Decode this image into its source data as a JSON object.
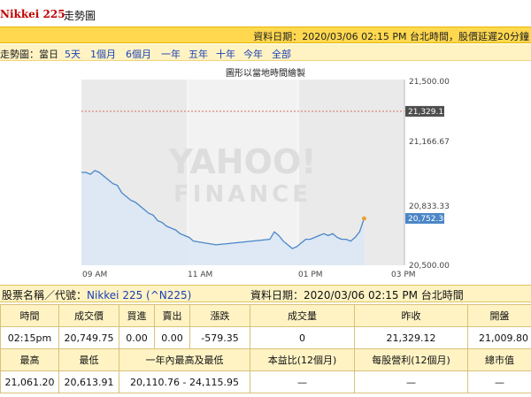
{
  "header": {
    "name": "Nikkei 225",
    "subtitle": "走勢圖"
  },
  "date_bar": {
    "text": "資料日期：2020/03/06 02:15 PM 台北時間，股價延遲20分鐘"
  },
  "range_bar": {
    "label": "走勢圖：當日",
    "ranges": [
      "5天",
      "1個月",
      "6個月",
      "一年",
      "五年",
      "十年",
      "今年",
      "全部"
    ]
  },
  "chart": {
    "caption": "圖形以當地時間繪製",
    "watermark_line1": "YAHOO!",
    "watermark_line2": "FINANCE",
    "x_labels": [
      "09 AM",
      "11 AM",
      "01 PM",
      "03 PM"
    ],
    "y_labels": [
      "21,500.00",
      "21,166.67",
      "20,833.33",
      "20,500.00"
    ],
    "prev_close_label": "21,329.12",
    "last_label": "20,752.30",
    "colors": {
      "line": "#4a86c7",
      "fill": "#dce8f4",
      "prev": "#d86a5a"
    }
  },
  "chart_data": {
    "type": "area",
    "title": "圖形以當地時間繪製",
    "x_labels": [
      "09 AM",
      "11 AM",
      "01 PM",
      "03 PM"
    ],
    "ylim": [
      20500,
      21500
    ],
    "y_ticks": [
      21500,
      21166.67,
      20833.33,
      20500
    ],
    "reference_line": 21329.12,
    "last_value": 20752.3,
    "series": [
      {
        "name": "",
        "x": [
          "09:00",
          "09:05",
          "09:10",
          "09:15",
          "09:20",
          "09:25",
          "09:30",
          "09:35",
          "09:40",
          "09:45",
          "09:50",
          "09:55",
          "10:00",
          "10:05",
          "10:10",
          "10:15",
          "10:20",
          "10:25",
          "10:30",
          "10:35",
          "10:40",
          "10:45",
          "10:50",
          "10:55",
          "11:00",
          "11:05",
          "11:30",
          "12:30",
          "12:35",
          "12:40",
          "12:45",
          "12:50",
          "12:55",
          "13:00",
          "13:05",
          "13:10",
          "13:15",
          "13:20",
          "13:25",
          "13:30",
          "13:35",
          "13:40",
          "13:45",
          "13:50",
          "13:55",
          "14:00",
          "14:05",
          "14:10",
          "14:15"
        ],
        "values": [
          21000,
          21000,
          20990,
          21010,
          21000,
          20980,
          20960,
          20940,
          20930,
          20890,
          20870,
          20850,
          20840,
          20820,
          20800,
          20780,
          20770,
          20740,
          20730,
          20710,
          20700,
          20690,
          20670,
          20660,
          20650,
          20630,
          20610,
          20640,
          20680,
          20660,
          20630,
          20610,
          20590,
          20600,
          20620,
          20640,
          20640,
          20650,
          20660,
          20670,
          20660,
          20670,
          20650,
          20640,
          20640,
          20630,
          20650,
          20680,
          20752
        ]
      }
    ],
    "grid": true
  },
  "info": {
    "name_label": "股票名稱／代號：",
    "name_value": "Nikkei 225 (^N225)",
    "date_text": "資料日期：2020/03/06 02:15 PM 台北時間"
  },
  "table": {
    "row1_headers": [
      "時間",
      "成交價",
      "買進",
      "賣出",
      "漲跌",
      "成交量",
      "昨收",
      "開盤"
    ],
    "row1_values": [
      "02:15pm",
      "20,749.75",
      "0.00",
      "0.00",
      "-579.35",
      "0",
      "21,329.12",
      "21,009.80"
    ],
    "row2_headers": [
      "最高",
      "最低",
      "一年內最高及最低",
      "本益比(12個月)",
      "每股營利(12個月)",
      "總市值"
    ],
    "row2_values": [
      "21,061.20",
      "20,613.91",
      "20,110.76 - 24,115.95",
      "—",
      "—",
      "—"
    ]
  }
}
